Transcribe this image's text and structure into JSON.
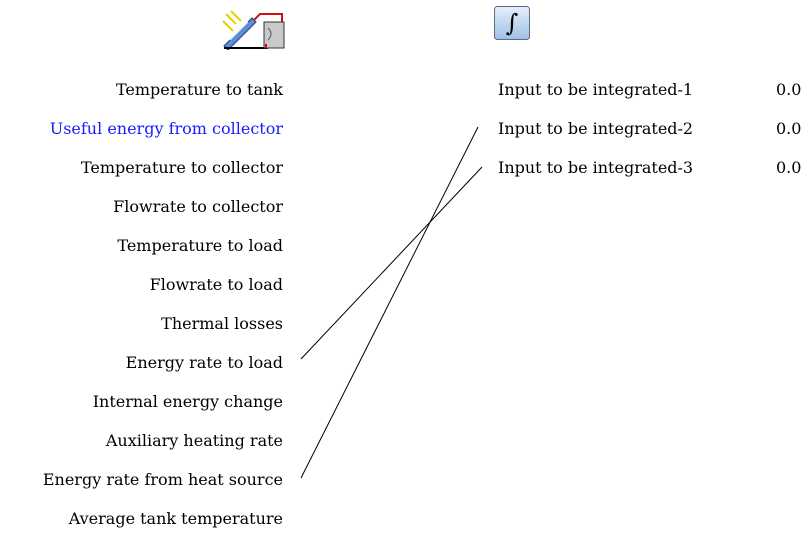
{
  "source_component": {
    "icon": "solar-storage-tank-icon",
    "outputs": [
      {
        "label": "Temperature to tank",
        "highlighted": false
      },
      {
        "label": "Useful energy from collector",
        "highlighted": true
      },
      {
        "label": "Temperature to collector",
        "highlighted": false
      },
      {
        "label": "Flowrate to collector",
        "highlighted": false
      },
      {
        "label": "Temperature to load",
        "highlighted": false
      },
      {
        "label": "Flowrate to load",
        "highlighted": false
      },
      {
        "label": "Thermal losses",
        "highlighted": false
      },
      {
        "label": "Energy rate to load",
        "highlighted": false
      },
      {
        "label": "Internal energy change",
        "highlighted": false
      },
      {
        "label": "Auxiliary heating rate",
        "highlighted": false
      },
      {
        "label": "Energy rate from heat source",
        "highlighted": false
      },
      {
        "label": "Average tank temperature",
        "highlighted": false
      }
    ]
  },
  "target_component": {
    "icon": "integrator-icon",
    "inputs": [
      {
        "label": "Input to be integrated-1",
        "value": "0.0"
      },
      {
        "label": "Input to be integrated-2",
        "value": "0.0"
      },
      {
        "label": "Input to be integrated-3",
        "value": "0.0"
      }
    ]
  },
  "connections": [
    {
      "from_output": "Energy rate to load",
      "to_input": "Input to be integrated-3"
    },
    {
      "from_output": "Energy rate from heat source",
      "to_input": "Input to be integrated-2"
    }
  ],
  "colors": {
    "highlight": "#1a1aff",
    "wire": "#000000"
  }
}
